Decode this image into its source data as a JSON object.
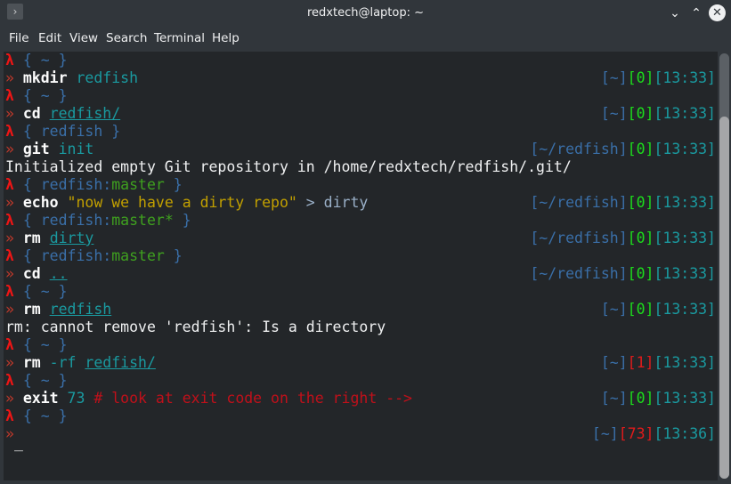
{
  "window": {
    "title": "redxtech@laptop: ~",
    "app_icon": "terminal-prompt-icon",
    "controls": {
      "minimize": "⌄",
      "maximize": "⌃",
      "close": "✕"
    }
  },
  "menu": {
    "items": [
      "File",
      "Edit",
      "View",
      "Search",
      "Terminal",
      "Help"
    ]
  },
  "prompt_symbols": {
    "lambda": "λ",
    "chevron": "»"
  },
  "lines": [
    {
      "type": "context",
      "dir": "~",
      "branch": ""
    },
    {
      "type": "command",
      "cmd": "mkdir",
      "args": " redfish",
      "right": {
        "dir": "~",
        "code": "0",
        "time": "13:33"
      }
    },
    {
      "type": "context",
      "dir": "~",
      "branch": ""
    },
    {
      "type": "command",
      "cmd": "cd",
      "args": "redfish/",
      "right": {
        "dir": "~",
        "code": "0",
        "time": "13:33"
      }
    },
    {
      "type": "context",
      "dir": "redfish",
      "branch": ""
    },
    {
      "type": "command",
      "cmd": "git",
      "args": " init",
      "right": {
        "dir": "~/redfish",
        "code": "0",
        "time": "13:33"
      }
    },
    {
      "type": "output",
      "text": "Initialized empty Git repository in /home/redxtech/redfish/.git/"
    },
    {
      "type": "context",
      "dir": "redfish",
      "branch": "master"
    },
    {
      "type": "command",
      "cmd": "echo",
      "string": " \"now we have a dirty repo\"",
      "redirect": " > dirty",
      "right": {
        "dir": "~/redfish",
        "code": "0",
        "time": "13:33"
      }
    },
    {
      "type": "context",
      "dir": "redfish",
      "branch": "master*"
    },
    {
      "type": "command",
      "cmd": "rm",
      "args": "dirty",
      "right": {
        "dir": "~/redfish",
        "code": "0",
        "time": "13:33"
      }
    },
    {
      "type": "context",
      "dir": "redfish",
      "branch": "master"
    },
    {
      "type": "command",
      "cmd": "cd",
      "args": "..",
      "right": {
        "dir": "~/redfish",
        "code": "0",
        "time": "13:33"
      }
    },
    {
      "type": "context",
      "dir": "~",
      "branch": ""
    },
    {
      "type": "command",
      "cmd": "rm",
      "args": "redfish",
      "right": {
        "dir": "~",
        "code": "0",
        "time": "13:33"
      }
    },
    {
      "type": "output",
      "text": "rm: cannot remove 'redfish': Is a directory"
    },
    {
      "type": "context",
      "dir": "~",
      "branch": ""
    },
    {
      "type": "command",
      "cmd": "rm",
      "flag": " -rf ",
      "args": "redfish/",
      "right": {
        "dir": "~",
        "code": "1",
        "time": "13:33"
      }
    },
    {
      "type": "context",
      "dir": "~",
      "branch": ""
    },
    {
      "type": "command",
      "cmd": "exit",
      "num": " 73",
      "comment": " # look at exit code on the right -->",
      "right": {
        "dir": "~",
        "code": "0",
        "time": "13:33"
      }
    },
    {
      "type": "context",
      "dir": "~",
      "branch": ""
    },
    {
      "type": "prompt",
      "cursor": "_",
      "right": {
        "dir": "~",
        "code": "73",
        "time": "13:36"
      }
    }
  ],
  "text": {
    "l0_ctx": " { ~ }",
    "l1_cmd": "mkdir",
    "l1_arg": " redfish",
    "l2_ctx": " { ~ }",
    "l3_cmd": "cd",
    "l3_arg": "redfish/",
    "l4_ctx_dir": "redfish",
    "l5_cmd": "git",
    "l5_arg": " init",
    "l6_out": "Initialized empty Git repository in /home/redxtech/redfish/.git/",
    "l7_dir": "redfish:",
    "l7_branch": "master",
    "l8_cmd": "echo",
    "l8_str": " \"now we have a dirty repo\"",
    "l8_redir": " > dirty",
    "l9_dir": "redfish:",
    "l9_branch": "master*",
    "l10_cmd": "rm",
    "l10_arg": "dirty",
    "l11_dir": "redfish:",
    "l11_branch": "master",
    "l12_cmd": "cd",
    "l12_arg": "..",
    "l13_ctx": " { ~ }",
    "l14_cmd": "rm",
    "l14_arg": "redfish",
    "l15_out": "rm: cannot remove 'redfish': Is a directory",
    "l16_ctx": " { ~ }",
    "l17_cmd": "rm",
    "l17_flag": " -rf ",
    "l17_arg": "redfish/",
    "l18_ctx": " { ~ }",
    "l19_cmd": "exit",
    "l19_num": " 73",
    "l19_comment": " # look at exit code on the right -->",
    "l20_ctx": " { ~ }",
    "l21_cursor": "_"
  },
  "right_prompts": [
    {
      "line": 1,
      "dir": "[~]",
      "code": "[0]",
      "time": "[13:33]",
      "status": "ok"
    },
    {
      "line": 3,
      "dir": "[~]",
      "code": "[0]",
      "time": "[13:33]",
      "status": "ok"
    },
    {
      "line": 5,
      "dir": "[~/redfish]",
      "code": "[0]",
      "time": "[13:33]",
      "status": "ok"
    },
    {
      "line": 8,
      "dir": "[~/redfish]",
      "code": "[0]",
      "time": "[13:33]",
      "status": "ok"
    },
    {
      "line": 10,
      "dir": "[~/redfish]",
      "code": "[0]",
      "time": "[13:33]",
      "status": "ok"
    },
    {
      "line": 12,
      "dir": "[~/redfish]",
      "code": "[0]",
      "time": "[13:33]",
      "status": "ok"
    },
    {
      "line": 14,
      "dir": "[~]",
      "code": "[0]",
      "time": "[13:33]",
      "status": "ok"
    },
    {
      "line": 17,
      "dir": "[~]",
      "code": "[1]",
      "time": "[13:33]",
      "status": "error"
    },
    {
      "line": 19,
      "dir": "[~]",
      "code": "[0]",
      "time": "[13:33]",
      "status": "ok"
    },
    {
      "line": 21,
      "dir": "[~]",
      "code": "[73]",
      "time": "[13:36]",
      "status": "error"
    }
  ],
  "colors": {
    "background": "#232629",
    "chrome": "#31363b",
    "lambda": "#ed1515",
    "ok": "#1cdc1c",
    "error": "#e01b1b",
    "time": "#1a9aa0",
    "dir": "#3a6fa8",
    "branch": "#3fa11f",
    "string": "#c2a000"
  },
  "scrollbar": {
    "position": "bottom"
  }
}
